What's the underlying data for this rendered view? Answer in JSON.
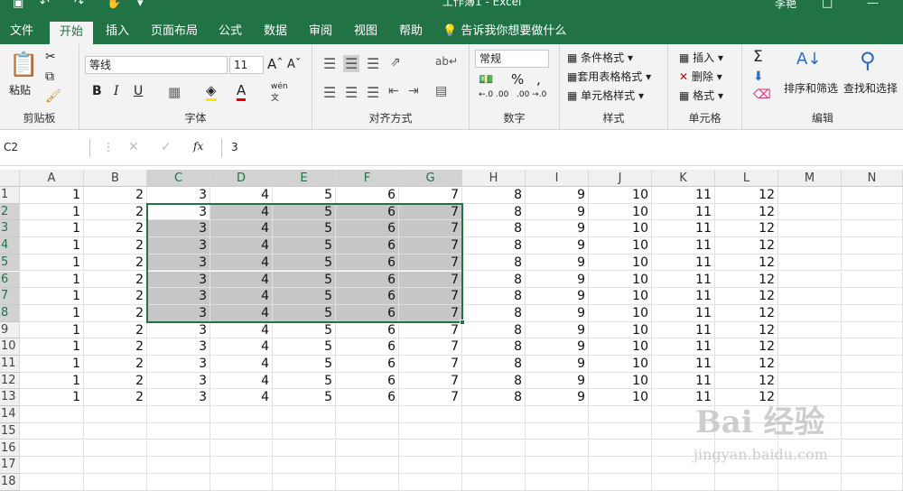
{
  "title_bar": {
    "title": "工作簿1 - Excel",
    "user": "李艳"
  },
  "tabs": [
    "文件",
    "开始",
    "插入",
    "页面布局",
    "公式",
    "数据",
    "审阅",
    "视图",
    "帮助"
  ],
  "tell_me": "告诉我你想要做什么",
  "ribbon": {
    "clipboard": {
      "paste": "粘贴",
      "label": "剪贴板"
    },
    "font": {
      "name": "等线",
      "size": "11",
      "label": "字体",
      "wen": "wén"
    },
    "alignment": {
      "label": "对齐方式"
    },
    "number": {
      "format": "常规",
      "label": "数字",
      "dec_inc": "←.0 .00",
      "dec_dec": ".00 →.0"
    },
    "styles": {
      "conditional": "条件格式",
      "table": "套用表格格式",
      "cell_styles": "单元格样式",
      "label": "样式"
    },
    "cells": {
      "insert": "插入",
      "delete": "删除",
      "format": "格式",
      "label": "单元格"
    },
    "editing": {
      "sort": "排序和筛选",
      "find": "查找和选择",
      "label": "编辑"
    }
  },
  "formula_bar": {
    "name_box": "C2",
    "value": "3",
    "fx": "fx"
  },
  "columns": [
    "A",
    "B",
    "C",
    "D",
    "E",
    "F",
    "G",
    "H",
    "I",
    "J",
    "K",
    "L",
    "M",
    "N"
  ],
  "rows": [
    "1",
    "2",
    "3",
    "4",
    "5",
    "6",
    "7",
    "8",
    "9",
    "10",
    "11",
    "12",
    "13",
    "14",
    "15",
    "16",
    "17",
    "18"
  ],
  "data_row": [
    "1",
    "2",
    "3",
    "4",
    "5",
    "6",
    "7",
    "8",
    "9",
    "10",
    "11",
    "12"
  ],
  "data_row_count": 13,
  "selection": {
    "range": "C2:G8"
  },
  "watermark": {
    "brand": "Bai 经验",
    "url": "jingyan.baidu.com"
  }
}
